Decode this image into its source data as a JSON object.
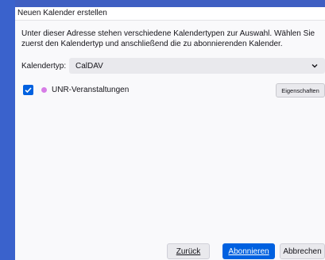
{
  "dialog": {
    "title": "Neuen Kalender erstellen",
    "description": "Unter dieser Adresse stehen verschiedene Kalendertypen zur Auswahl. Wählen Sie zuerst den Kalendertyp und anschließend die zu abonnierenden Kalender.",
    "type_label": "Kalendertyp:",
    "type_value": "CalDAV"
  },
  "calendars": [
    {
      "name": "UNR-Veranstaltungen",
      "checked": true,
      "color": "#d77de6",
      "properties_label": "Eigenschaften"
    }
  ],
  "buttons": {
    "back": "Zurück",
    "subscribe": "Abonnieren",
    "cancel": "Abbrechen"
  },
  "colors": {
    "accent": "#0061e0",
    "desktop": "#3f5fc2"
  }
}
